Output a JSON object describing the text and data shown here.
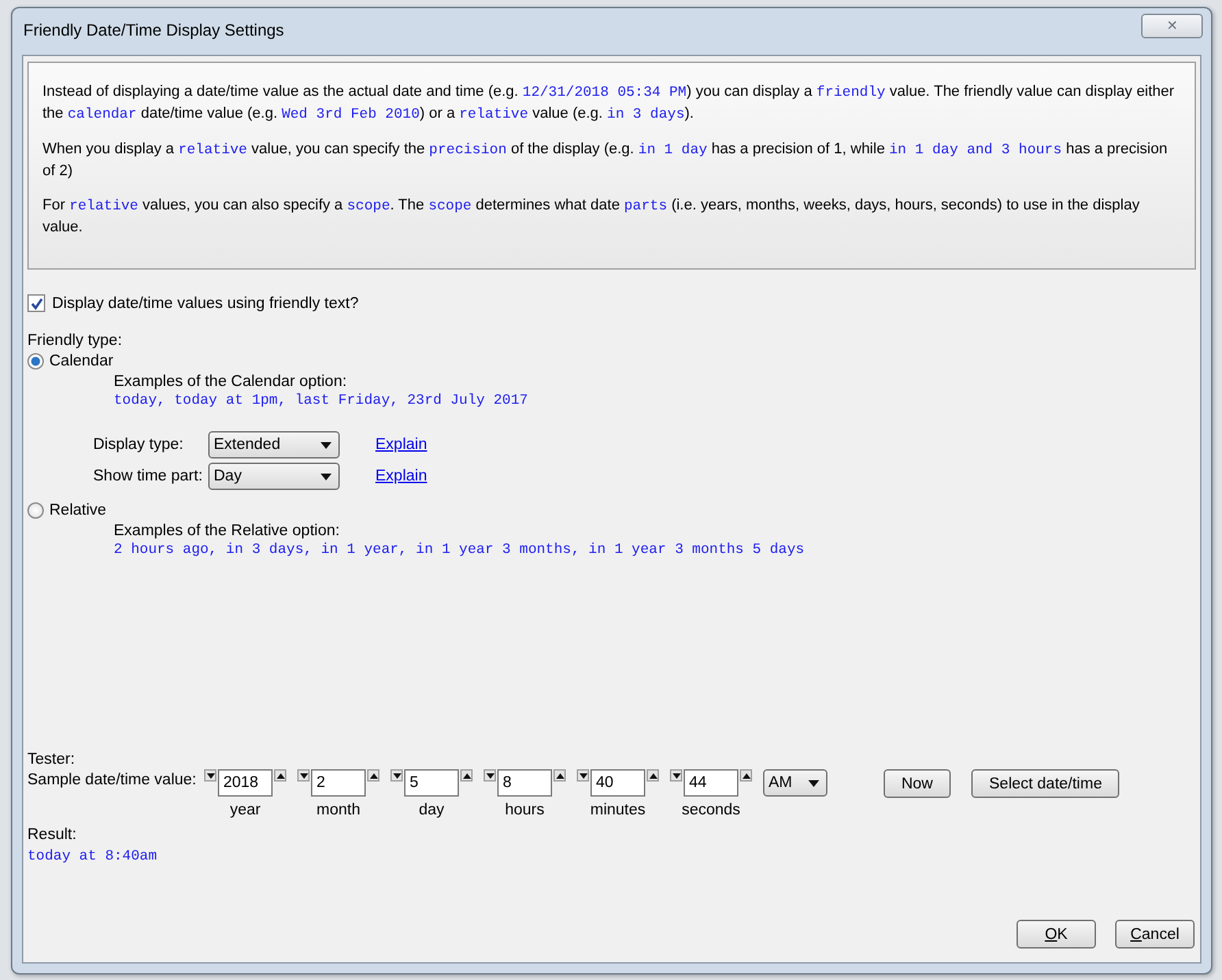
{
  "window": {
    "title": "Friendly Date/Time Display Settings",
    "close": "✕"
  },
  "info": [
    [
      {
        "t": "Instead of displaying a date/time value as the actual date and time (e.g. ",
        "code": false
      },
      {
        "t": "12/31/2018 05:34 PM",
        "code": true
      },
      {
        "t": ") you can display a ",
        "code": false
      },
      {
        "t": "friendly",
        "code": true
      },
      {
        "t": " value. The friendly value can display either the ",
        "code": false
      },
      {
        "t": "calendar",
        "code": true
      },
      {
        "t": " date/time value (e.g. ",
        "code": false
      },
      {
        "t": "Wed 3rd Feb 2010",
        "code": true
      },
      {
        "t": ") or a ",
        "code": false
      },
      {
        "t": "relative",
        "code": true
      },
      {
        "t": " value (e.g. ",
        "code": false
      },
      {
        "t": "in 3 days",
        "code": true
      },
      {
        "t": ").",
        "code": false
      }
    ],
    [
      {
        "t": "When you display a ",
        "code": false
      },
      {
        "t": "relative",
        "code": true
      },
      {
        "t": " value, you can specify the ",
        "code": false
      },
      {
        "t": "precision",
        "code": true
      },
      {
        "t": " of the display (e.g. ",
        "code": false
      },
      {
        "t": "in 1 day",
        "code": true
      },
      {
        "t": " has a precision of 1, while ",
        "code": false
      },
      {
        "t": "in 1 day and 3 hours",
        "code": true
      },
      {
        "t": " has a precision of 2)",
        "code": false
      }
    ],
    [
      {
        "t": "For ",
        "code": false
      },
      {
        "t": "relative",
        "code": true
      },
      {
        "t": " values, you can also specify a ",
        "code": false
      },
      {
        "t": "scope",
        "code": true
      },
      {
        "t": ". The ",
        "code": false
      },
      {
        "t": "scope",
        "code": true
      },
      {
        "t": " determines what date ",
        "code": false
      },
      {
        "t": "parts",
        "code": true
      },
      {
        "t": " (i.e. years, months, weeks, days, hours, seconds) to use in the display value.",
        "code": false
      }
    ]
  ],
  "friendly_checkbox": {
    "label": "Display date/time values using friendly text?",
    "checked": true
  },
  "friendly_type_label": "Friendly type:",
  "options": [
    {
      "label": "Calendar",
      "selected": true,
      "examples_label": "Examples of the Calendar option:",
      "examples": "today, today at 1pm, last Friday, 23rd July 2017",
      "settings": [
        {
          "label": "Display type:",
          "value": "Extended",
          "link": "Explain"
        },
        {
          "label": "Show time part:",
          "value": "Day",
          "link": "Explain"
        }
      ]
    },
    {
      "label": "Relative",
      "selected": false,
      "examples_label": "Examples of the Relative option:",
      "examples": "2 hours ago, in 3 days, in 1 year, in 1 year 3 months, in 1 year 3 months 5 days"
    }
  ],
  "tester": {
    "title": "Tester:",
    "sample_label": "Sample date/time value:",
    "spinners": [
      {
        "value": "2018",
        "label": "year"
      },
      {
        "value": "2",
        "label": "month"
      },
      {
        "value": "5",
        "label": "day"
      },
      {
        "value": "8",
        "label": "hours"
      },
      {
        "value": "40",
        "label": "minutes"
      },
      {
        "value": "44",
        "label": "seconds"
      }
    ],
    "ampm": "AM",
    "buttons": [
      "Now",
      "Select date/time"
    ],
    "result_label": "Result:",
    "result": "today at 8:40am"
  },
  "footer_buttons": [
    {
      "label": "OK",
      "underline_first": true
    },
    {
      "label": "Cancel",
      "underline_first": true
    }
  ]
}
